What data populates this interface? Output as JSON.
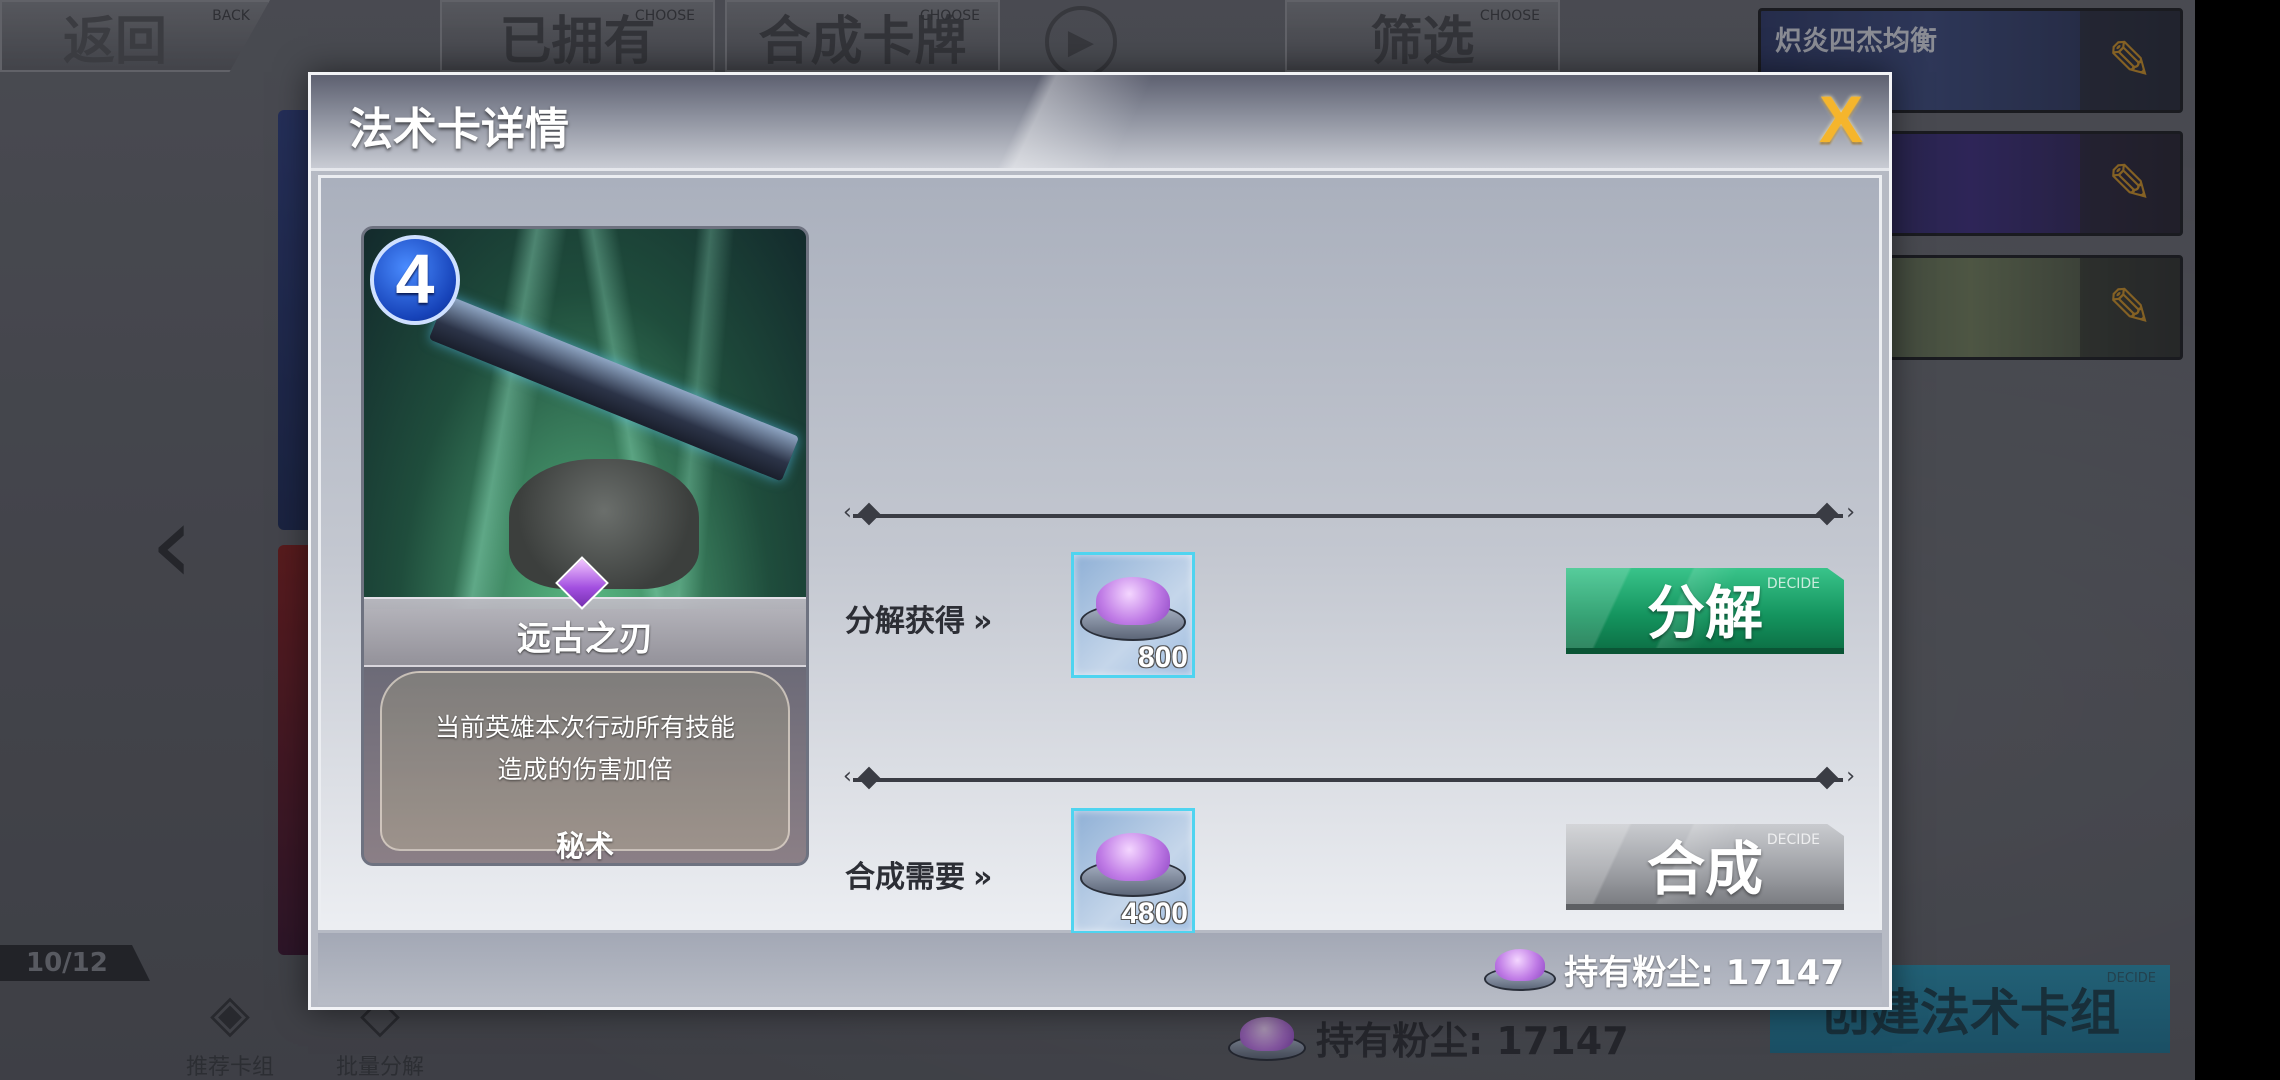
{
  "background": {
    "back_button": {
      "label": "返回",
      "sub": "BACK"
    },
    "tabs": [
      {
        "label": "已拥有",
        "sub": "CHOOSE"
      },
      {
        "label": "合成卡牌",
        "sub": "CHOOSE"
      }
    ],
    "filter_button": {
      "label": "筛选",
      "sub": "CHOOSE"
    },
    "deck_slots": [
      {
        "name": "炽炎四杰均衡"
      },
      {
        "name": ""
      },
      {
        "name": ""
      }
    ],
    "count_badge": "10/12",
    "tools": [
      {
        "label": "推荐卡组"
      },
      {
        "label": "批量分解"
      }
    ],
    "dust_label": "持有粉尘: 17147",
    "create_deck_button": {
      "label": "创建法术卡组",
      "sub": "DECIDE"
    }
  },
  "modal": {
    "title": "法术卡详情",
    "close_label": "X",
    "card": {
      "cost": "4",
      "name": "远古之刃",
      "description_line1": "当前英雄本次行动所有技能",
      "description_line2": "造成的伤害加倍",
      "type": "秘术"
    },
    "decompose": {
      "label": "分解获得",
      "amount": "800",
      "button_label": "分解",
      "button_sub": "DECIDE"
    },
    "compose": {
      "label": "合成需要",
      "amount": "4800",
      "button_label": "合成",
      "button_sub": "DECIDE"
    },
    "footer": {
      "dust_label": "持有粉尘: 17147"
    }
  },
  "colors": {
    "decompose_button": "#14945e",
    "compose_button": "#9d9fa4",
    "close_x": "#f5b52c",
    "cost_orb": "#1642b8",
    "dust_purple": "#c07ce6"
  }
}
